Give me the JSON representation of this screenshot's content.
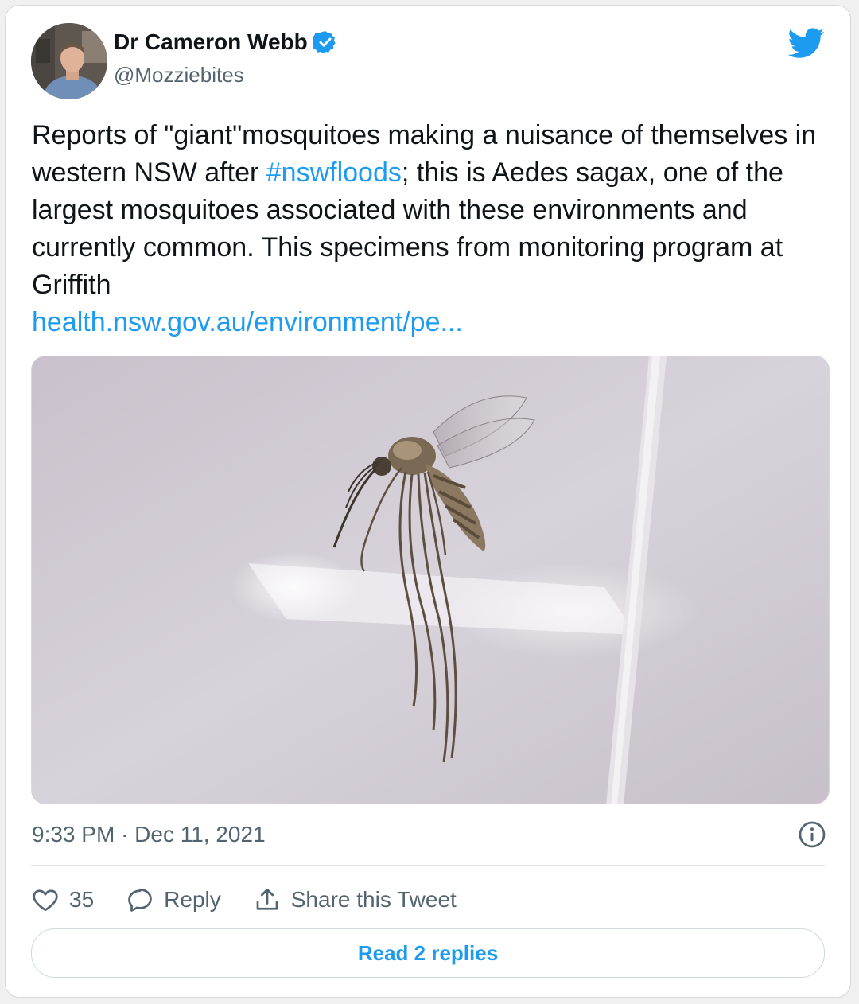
{
  "author": {
    "display_name": "Dr Cameron Webb",
    "handle": "@Mozziebites",
    "verified": true
  },
  "tweet": {
    "text_before_hashtag": "Reports of \"giant\"mosquitoes making a nuisance of themselves in western NSW after ",
    "hashtag": "#nswfloods",
    "text_after_hashtag": "; this is Aedes sagax, one of the largest mosquitoes associated with these environments and currently common. This specimens from monitoring program at Griffith",
    "link": "health.nsw.gov.au/environment/pe..."
  },
  "meta": {
    "timestamp": "9:33 PM · Dec 11, 2021"
  },
  "actions": {
    "like_count": "35",
    "reply_label": "Reply",
    "share_label": "Share this Tweet"
  },
  "read_replies_label": "Read 2 replies",
  "icons": {
    "brand": "twitter-bird-icon",
    "verified": "verified-badge-icon",
    "info": "info-icon",
    "like": "heart-icon",
    "reply": "speech-bubble-icon",
    "share": "share-upload-icon"
  },
  "colors": {
    "brand_blue": "#1d9bf0",
    "text_primary": "#0f1419",
    "text_secondary": "#536471"
  }
}
